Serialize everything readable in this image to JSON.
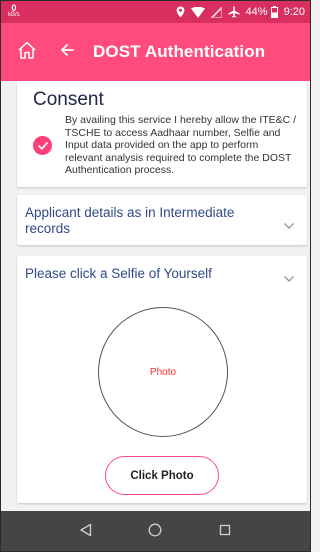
{
  "statusbar": {
    "net_speed_value": "0",
    "net_speed_unit": "kB/s",
    "battery": "44%",
    "time": "9:20"
  },
  "appbar": {
    "title": "DOST Authentication",
    "background": "#ff4c7c"
  },
  "consent": {
    "title": "Consent",
    "checked": true,
    "text": "By availing this service I hereby allow the ITE&C / TSCHE to access Aadhaar number, Selfie and Input data provided on the app to perform relevant analysis required to complete the DOST Authentication process."
  },
  "applicant": {
    "label": "Applicant details as in Intermediate records"
  },
  "selfie": {
    "label": "Please click a Selfie of Yourself",
    "photo_placeholder": "Photo",
    "button_label": "Click Photo"
  },
  "icons": {
    "home": "home-icon",
    "back": "arrow-left-icon",
    "check": "check-icon",
    "chevron": "chevron-down-icon",
    "nav_back": "triangle-back-icon",
    "nav_home": "circle-home-icon",
    "nav_recents": "square-recents-icon"
  },
  "colors": {
    "accent": "#ff4c7c",
    "status_bar": "#d92f60",
    "link_text": "#304a87",
    "photo_text": "#ff2d2d",
    "nav_bar": "#454545"
  }
}
